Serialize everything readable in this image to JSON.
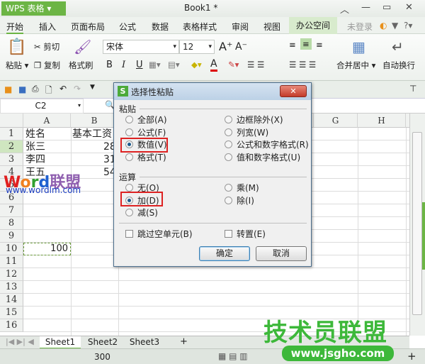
{
  "app": {
    "logo": "WPS 表格",
    "title": "Book1 *"
  },
  "tabs": [
    "开始",
    "插入",
    "页面布局",
    "公式",
    "数据",
    "表格样式",
    "审阅",
    "视图",
    "办公空间"
  ],
  "login": "未登录",
  "ribbon": {
    "paste": "粘贴",
    "cut": "剪切",
    "copy": "复制",
    "format_painter": "格式刷",
    "font": "宋体",
    "size": "12",
    "bold": "B",
    "italic": "I",
    "underline": "U",
    "merge": "合并居中",
    "wrap": "自动换行"
  },
  "namebox": "C2",
  "columns": [
    "A",
    "B",
    "G",
    "H"
  ],
  "rows": [
    "1",
    "2",
    "3",
    "4",
    "5",
    "6",
    "7",
    "8",
    "9",
    "10",
    "11",
    "12",
    "13",
    "14",
    "15",
    "16"
  ],
  "cells": {
    "a1": "姓名",
    "b1": "基本工资",
    "a2": "张三",
    "b2": "2800",
    "a3": "李四",
    "b3": "3100",
    "a4": "王五",
    "b4": "5400",
    "a10": "100"
  },
  "sheets": [
    "Sheet1",
    "Sheet2",
    "Sheet3"
  ],
  "status": {
    "sum": "300"
  },
  "dialog": {
    "title": "选择性粘贴",
    "paste_group": "粘贴",
    "paste_options": [
      "全部(A)",
      "公式(F)",
      "数值(V)",
      "格式(T)",
      "边框除外(X)",
      "列宽(W)",
      "公式和数字格式(R)",
      "值和数字格式(U)"
    ],
    "paste_selected": "数值(V)",
    "op_group": "运算",
    "op_options": [
      "无(O)",
      "加(D)",
      "减(S)",
      "乘(M)",
      "除(I)"
    ],
    "op_selected": "加(D)",
    "skip_blanks": "跳过空单元(B)",
    "transpose": "转置(E)",
    "ok": "确定",
    "cancel": "取消"
  },
  "watermarks": {
    "w1": "Word联盟",
    "w1url": "www.wordlm.com",
    "w2": "技术员联盟",
    "w2url": "www.jsgho.com"
  },
  "colors": {
    "accent": "#6cb545",
    "highlight_red": "#dd2222"
  }
}
